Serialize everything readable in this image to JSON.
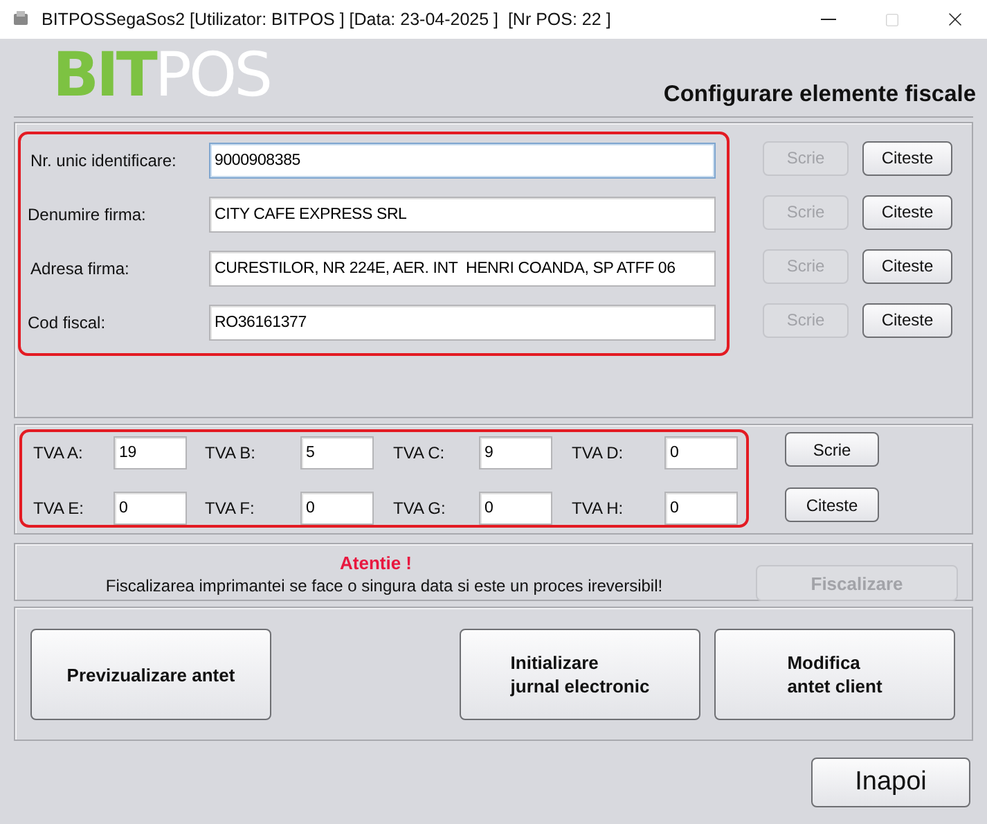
{
  "window": {
    "title": "BITPOSSegaSos2 [Utilizator: BITPOS ] [Data: 23-04-2025 ]  [Nr POS: 22 ]",
    "maximize_disabled": true
  },
  "logo": {
    "part_1": "BIT",
    "part_2": "POS"
  },
  "heading": "Configurare elemente fiscale",
  "identity": {
    "highlighted": true,
    "rows": [
      {
        "label": "Nr. unic identificare:",
        "value": "9000908385",
        "focused": true,
        "buttons": [
          {
            "label": "Scrie",
            "disabled": true
          },
          {
            "label": "Citeste",
            "disabled": false
          }
        ]
      },
      {
        "label": "Denumire firma:",
        "value": "CITY CAFE EXPRESS SRL",
        "focused": false,
        "buttons": [
          {
            "label": "Scrie",
            "disabled": true
          },
          {
            "label": "Citeste",
            "disabled": false
          }
        ]
      },
      {
        "label": "Adresa firma:",
        "value": "CURESTILOR, NR 224E, AER. INT  HENRI COANDA, SP ATFF 06",
        "focused": false,
        "buttons": [
          {
            "label": "Scrie",
            "disabled": true
          },
          {
            "label": "Citeste",
            "disabled": false
          }
        ]
      },
      {
        "label": "Cod fiscal:",
        "value": "RO36161377",
        "focused": false,
        "buttons": [
          {
            "label": "Scrie",
            "disabled": true
          },
          {
            "label": "Citeste",
            "disabled": false
          }
        ]
      }
    ]
  },
  "vat": {
    "highlighted": true,
    "rates": [
      {
        "label": "TVA A:",
        "value": "19"
      },
      {
        "label": "TVA B:",
        "value": "5"
      },
      {
        "label": "TVA C:",
        "value": "9"
      },
      {
        "label": "TVA D:",
        "value": "0"
      },
      {
        "label": "TVA E:",
        "value": "0"
      },
      {
        "label": "TVA F:",
        "value": "0"
      },
      {
        "label": "TVA G:",
        "value": "0"
      },
      {
        "label": "TVA H:",
        "value": "0"
      }
    ],
    "buttons": [
      {
        "label": "Scrie",
        "disabled": false
      },
      {
        "label": "Citeste",
        "disabled": false
      }
    ]
  },
  "fiscalization": {
    "warning_title": "Atentie !",
    "warning": "Fiscalizarea imprimantei se face o singura data si este un proces ireversibil!",
    "button": {
      "label": "Fiscalizare",
      "disabled": true
    }
  },
  "actions": [
    {
      "label": "Previzualizare antet"
    },
    {
      "label": "Initializare\njurnal electronic"
    },
    {
      "label": "Modifica\nantet client"
    }
  ],
  "back_button": "Inapoi"
}
